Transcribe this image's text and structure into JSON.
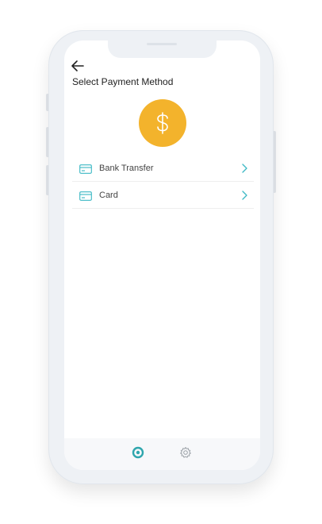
{
  "header": {
    "back_icon": "arrow-left-icon",
    "title": "Select Payment Method"
  },
  "hero": {
    "icon": "dollar-sign-icon",
    "color": "#f3b32c"
  },
  "methods": [
    {
      "icon": "credit-card-icon",
      "label": "Bank Transfer",
      "action_icon": "chevron-right-icon"
    },
    {
      "icon": "credit-card-icon",
      "label": "Card",
      "action_icon": "chevron-right-icon"
    }
  ],
  "tabbar": {
    "items": [
      {
        "icon": "home-circle-icon",
        "active": true
      },
      {
        "icon": "settings-gear-icon",
        "active": false
      }
    ]
  },
  "colors": {
    "accent": "#3bb8c4",
    "coin": "#f3b32c",
    "text": "#222222"
  }
}
